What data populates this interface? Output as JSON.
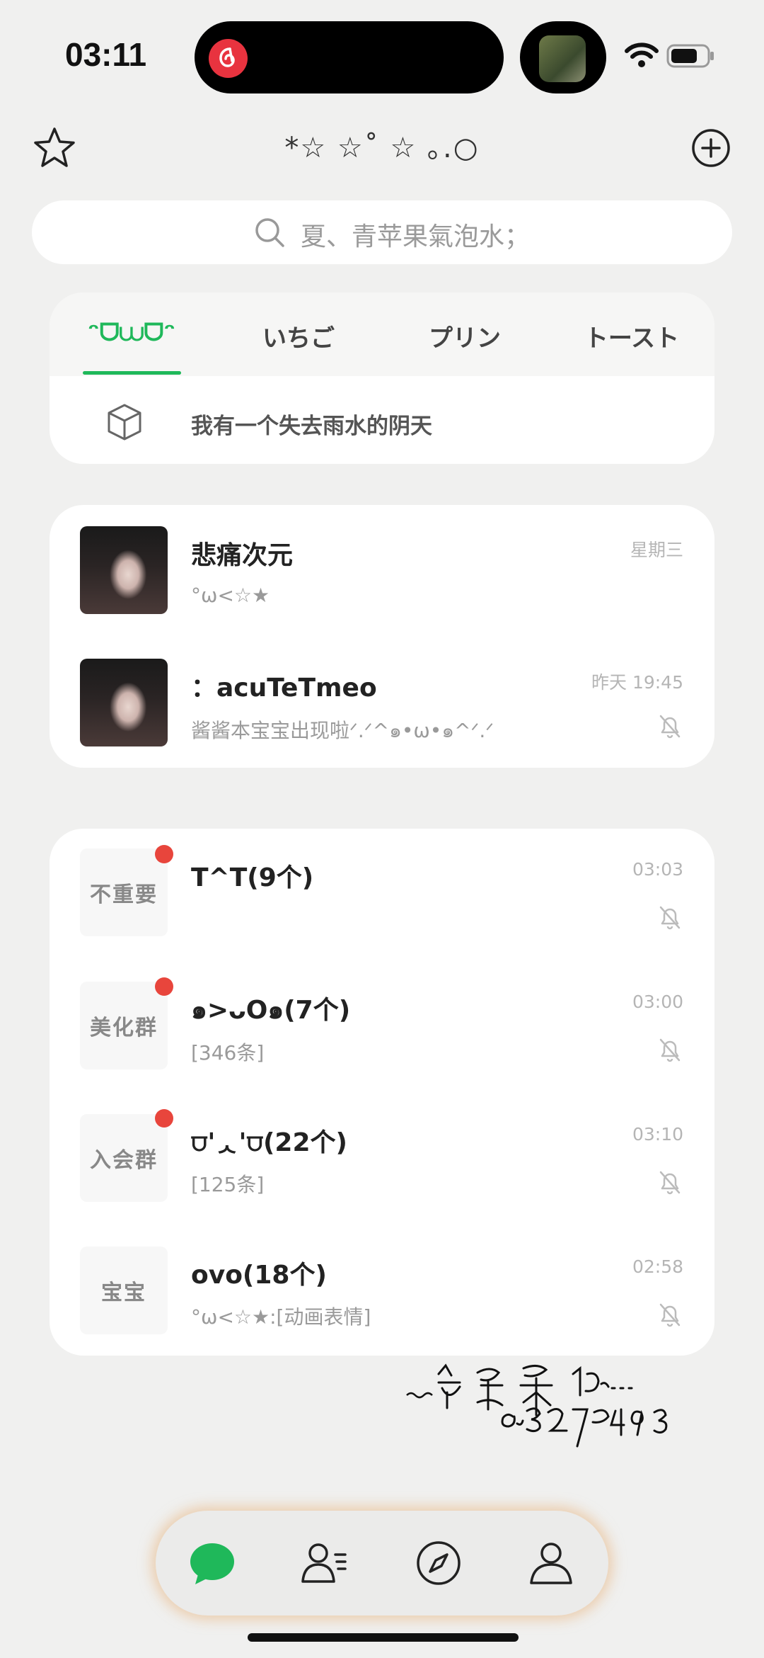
{
  "status": {
    "time": "03:11"
  },
  "header": {
    "title": "*☆ ☆˚ ☆ ｡.○"
  },
  "search": {
    "placeholder": "夏、青苹果氣泡水；"
  },
  "tabs": [
    {
      "label": "ᵔᗜ⩊ᗜᵔ",
      "active": true
    },
    {
      "label": "いちご",
      "active": false
    },
    {
      "label": "プリン",
      "active": false
    },
    {
      "label": "トースト",
      "active": false
    }
  ],
  "notice": {
    "text": "我有一个失去雨水的阴天"
  },
  "pinned_chats": [
    {
      "name": "悲痛次元",
      "preview": "°ω<☆★",
      "time": "星期三",
      "muted": false
    },
    {
      "name": "：acuTeTmeo",
      "preview": "酱酱本宝宝出现啦ᐟ.ᐟ^๑•ω•๑^ᐟ.ᐟ",
      "time": "昨天 19:45",
      "muted": true
    }
  ],
  "group_chats": [
    {
      "avatar_text": "不重要",
      "name": "T^T(9个)",
      "preview": "",
      "time": "03:03",
      "unread": true,
      "muted": true
    },
    {
      "avatar_text": "美化群",
      "name": "๑>ᴗO๑(7个)",
      "preview": "[346条]",
      "time": "03:00",
      "unread": true,
      "muted": true
    },
    {
      "avatar_text": "入会群",
      "name": "⩌'ᆺ'⩌(22个)",
      "preview": "[125条]",
      "time": "03:10",
      "unread": true,
      "muted": true
    },
    {
      "avatar_text": "宝宝",
      "name": "ovo(18个)",
      "preview": "°ω<☆★:[动画表情]",
      "time": "02:58",
      "unread": false,
      "muted": true
    }
  ],
  "signature": {
    "line1": "…宝呆呆的…",
    "line2": "@3027924963"
  },
  "nav": {
    "items": [
      "chat-bubble-icon",
      "contacts-icon",
      "compass-icon",
      "profile-icon"
    ],
    "active_color": "#1fb85a"
  }
}
